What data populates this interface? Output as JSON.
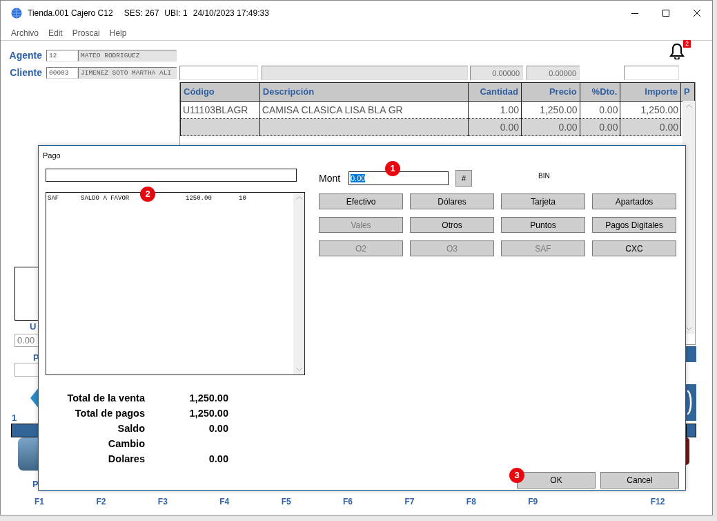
{
  "window": {
    "title": "Tienda.001  Cajero C12",
    "session": "SES: 267",
    "location": "UBI: 1",
    "datetime": "24/10/2023 17:49:33"
  },
  "menu": [
    "Archivo",
    "Edit",
    "Proscai",
    "Help"
  ],
  "notifications": {
    "count": "2"
  },
  "agent": {
    "label": "Agente",
    "code": "12",
    "name": "MATEO RODRIGUEZ"
  },
  "client": {
    "label": "Cliente",
    "code": "00003",
    "name": "JIMENEZ SOTO MARTHA ALI"
  },
  "document_fields": [
    "0.00000",
    "0.00000"
  ],
  "grid": {
    "columns": [
      "Código",
      "Descripción",
      "Cantidad",
      "Precio",
      "%Dto.",
      "Importe",
      "P"
    ],
    "rows": [
      {
        "kind": "item",
        "cells": [
          "U11103BLAGR",
          "CAMISA CLASICA LISA BLA GR",
          "1.00",
          "1,250.00",
          "0.00",
          "1,250.00"
        ]
      },
      {
        "kind": "new",
        "cells": [
          null,
          null,
          "0.00",
          "0.00",
          "0.00",
          "0.00"
        ]
      }
    ]
  },
  "fragments": [
    {
      "kind": "label",
      "text": "U"
    },
    {
      "kind": "field",
      "text": "0.00"
    },
    {
      "kind": "label",
      "text": "P"
    },
    {
      "kind": "label",
      "text": "1"
    },
    {
      "kind": "label",
      "text": "P"
    }
  ],
  "function_keys": [
    "F1",
    "F2",
    "F3",
    "F4",
    "F5",
    "F6",
    "F7",
    "F8",
    "F9",
    "F12"
  ],
  "dialog": {
    "title": "Pago",
    "amount": {
      "label": "Mont",
      "value": "0.00",
      "text_selected": true
    },
    "hash_button": "#",
    "bin_label": "BIN",
    "payment_buttons": [
      {
        "label": "Efectivo",
        "disabled": false
      },
      {
        "label": "Dólares",
        "disabled": false
      },
      {
        "label": "Tarjeta",
        "disabled": false
      },
      {
        "label": "Apartados",
        "disabled": false
      },
      {
        "label": "Vales",
        "disabled": true
      },
      {
        "label": "Otros",
        "disabled": false
      },
      {
        "label": "Puntos",
        "disabled": false
      },
      {
        "label": "Pagos Digitales",
        "disabled": false
      },
      {
        "label": "O2",
        "disabled": true
      },
      {
        "label": "O3",
        "disabled": true
      },
      {
        "label": "SAF",
        "disabled": true
      },
      {
        "label": "CXC",
        "disabled": false
      }
    ],
    "payments": [
      {
        "cells": [
          "SAF",
          "SALDO A FAVOR",
          "1250.00",
          "10"
        ]
      }
    ],
    "totals": [
      {
        "label": "Total de la venta",
        "value": "1,250.00"
      },
      {
        "label": "Total de pagos",
        "value": "1,250.00"
      },
      {
        "label": "Saldo",
        "value": "0.00"
      },
      {
        "label": "Cambio"
      },
      {
        "label": "Dolares",
        "value": "0.00"
      }
    ],
    "buttons": [
      "OK",
      "Cancel"
    ]
  },
  "markers": [
    "1",
    "2",
    "3"
  ]
}
